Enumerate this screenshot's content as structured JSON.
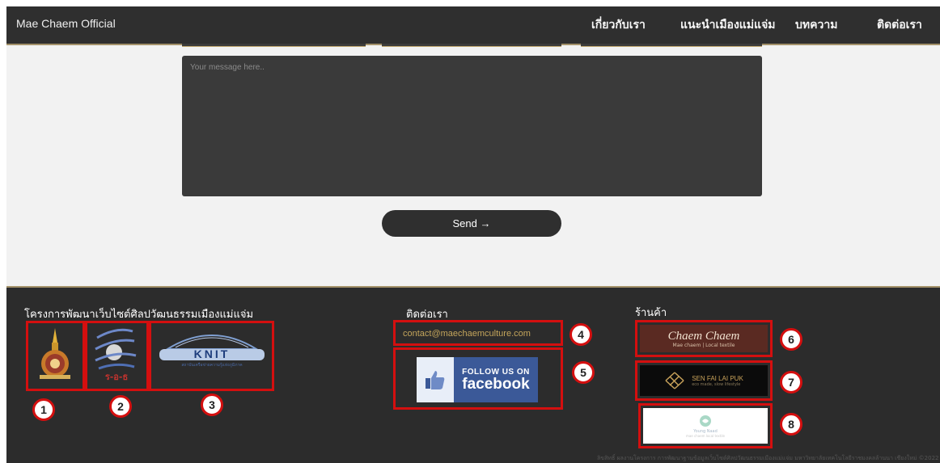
{
  "header": {
    "brand": "Mae Chaem Official",
    "nav": [
      "เกี่ยวกับเรา",
      "แนะนำเมืองแม่แจ่ม",
      "บทความ",
      "ติดต่อเรา"
    ]
  },
  "form": {
    "message_placeholder": "Your message here..",
    "send_label": "Send →"
  },
  "footer": {
    "project_heading": "โครงการพัฒนาเว็บไซต์ศิลปวัฒนธรรมเมืองแม่แจ่ม",
    "contact_heading": "ติดต่อเรา",
    "shop_heading": "ร้านค้า",
    "email": "contact@maechaemculture.com",
    "facebook": {
      "small": "FOLLOW US ON",
      "big": "facebook"
    },
    "partner_logos": {
      "logo2_text": "ร-อ-ธ",
      "knit_title": "KNIT",
      "knit_subtitle": "สถาบันเครือข่ายความรู้แห่งภูมิภาค"
    },
    "shops": [
      {
        "name": "Chaem Chaem",
        "tagline": "Mae chaem | Local textile"
      },
      {
        "name": "SEN FAI LAI PUK",
        "tagline": "eco made, slow lifestyle"
      },
      {
        "name": "Young Naad",
        "tagline": "mae chaem local textile"
      }
    ],
    "copyright": "ลิขสิทธิ์ ผลงานโครงการ การพัฒนาฐานข้อมูลเว็บไซต์ศิลปวัฒนธรรมเมืองแม่แจ่ม มหาวิทยาลัยเทคโนโลยีราชมงคลล้านนา เชียงใหม่ ©2022"
  },
  "annotations": [
    "1",
    "2",
    "3",
    "4",
    "5",
    "6",
    "7",
    "8"
  ],
  "colors": {
    "accent": "#d40f0f",
    "gold": "#c4a55b",
    "dark": "#2c2c2c",
    "facebook": "#3b5998"
  }
}
